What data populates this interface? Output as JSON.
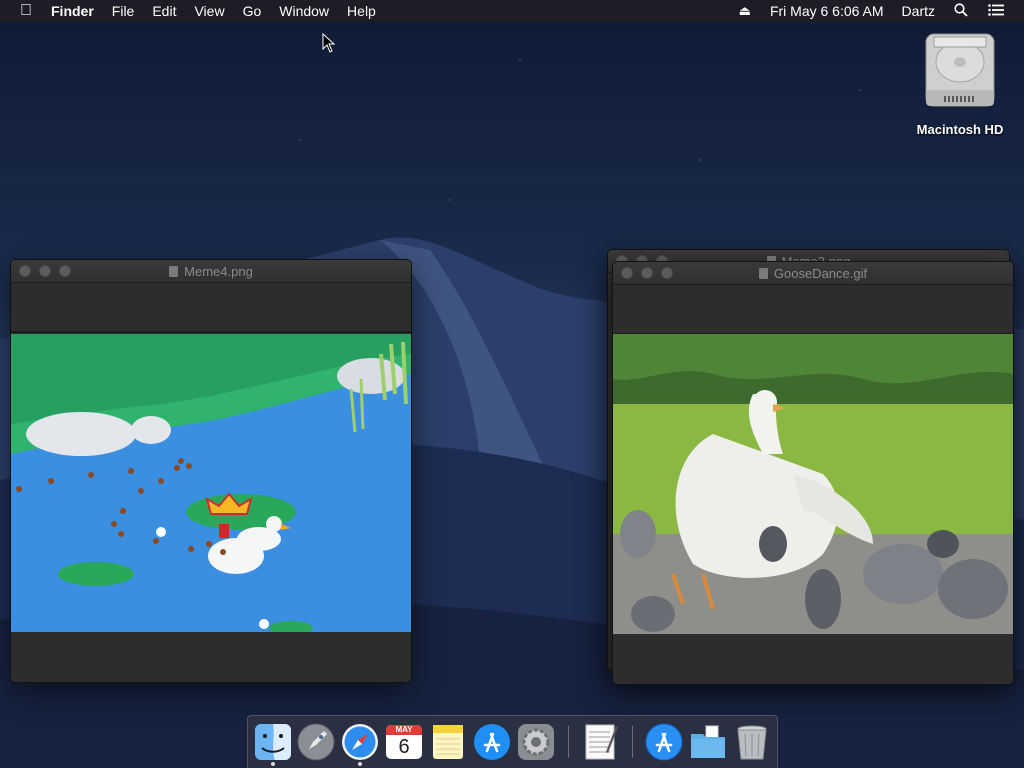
{
  "menubar": {
    "app_name": "Finder",
    "items": [
      "File",
      "Edit",
      "View",
      "Go",
      "Window",
      "Help"
    ],
    "clock": "Fri May 6  6:06 AM",
    "user": "Dartz"
  },
  "desktop": {
    "hd_label": "Macintosh HD"
  },
  "windows": {
    "meme4": {
      "title": "Meme4.png"
    },
    "meme3": {
      "title": "Meme3.png"
    },
    "goose": {
      "title": "GooseDance.gif"
    }
  },
  "dock": {
    "calendar_month": "MAY",
    "calendar_day": "6",
    "items": [
      "finder",
      "launchpad",
      "safari",
      "calendar",
      "notes",
      "app-store",
      "system-preferences",
      "textedit",
      "applications",
      "documents",
      "trash"
    ]
  }
}
